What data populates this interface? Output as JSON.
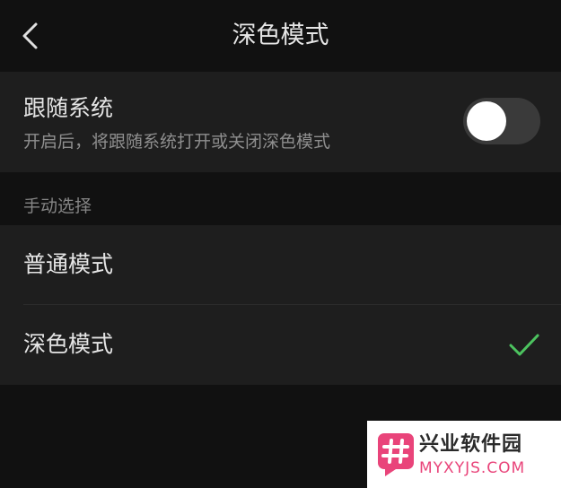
{
  "nav": {
    "title": "深色模式",
    "back_icon": "chevron-left-icon"
  },
  "follow_system": {
    "title": "跟随系统",
    "subtitle": "开启后，将跟随系统打开或关闭深色模式",
    "enabled": false
  },
  "manual": {
    "section_label": "手动选择",
    "options": [
      {
        "label": "普通模式",
        "selected": false
      },
      {
        "label": "深色模式",
        "selected": true
      }
    ]
  },
  "watermark": {
    "name": "兴业软件园",
    "url": "MYXYJS.COM"
  },
  "colors": {
    "background": "#111111",
    "card": "#1e1e1e",
    "check": "#4cc35f",
    "watermark_accent": "#e9447a"
  }
}
